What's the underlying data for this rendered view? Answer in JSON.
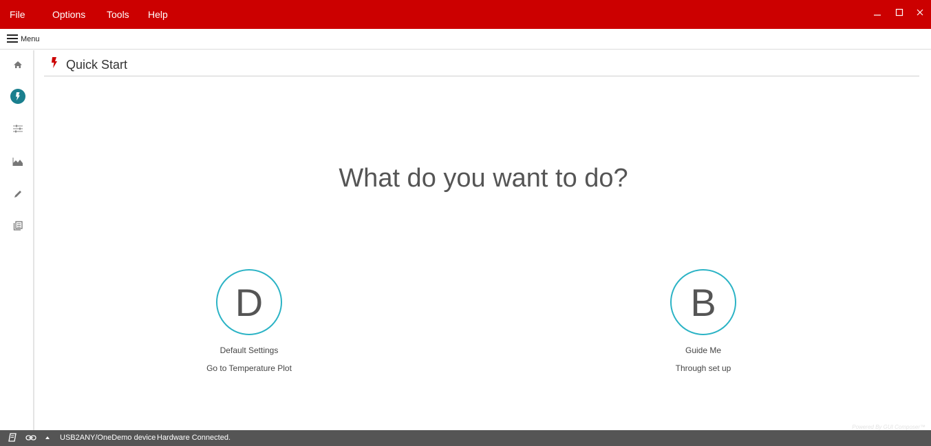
{
  "menubar": {
    "items": [
      "File",
      "Options",
      "Tools",
      "Help"
    ]
  },
  "window_controls": {
    "minimize_icon": "minimize-icon",
    "maximize_icon": "maximize-icon",
    "close_icon": "close-icon"
  },
  "secondary_menu": {
    "label": "Menu",
    "icon": "hamburger-icon"
  },
  "sidebar": {
    "items": [
      {
        "name": "home",
        "icon": "home-icon",
        "active": false
      },
      {
        "name": "quick-start",
        "icon": "bolt-icon",
        "active": true
      },
      {
        "name": "settings",
        "icon": "sliders-icon",
        "active": false
      },
      {
        "name": "plot",
        "icon": "area-chart-icon",
        "active": false
      },
      {
        "name": "edit",
        "icon": "pencil-icon",
        "active": false
      },
      {
        "name": "docs",
        "icon": "document-icon",
        "active": false
      }
    ]
  },
  "page": {
    "title": "Quick Start",
    "question": "What do you want to do?"
  },
  "options": [
    {
      "letter": "D",
      "line1": "Default Settings",
      "line2": "Go to Temperature Plot"
    },
    {
      "letter": "B",
      "line1": "Guide Me",
      "line2": "Through set up"
    }
  ],
  "status": {
    "device": "USB2ANY/OneDemo device",
    "connection": "Hardware Connected."
  },
  "footer": {
    "powered_by": "Powered By GUI Composer™"
  },
  "colors": {
    "titlebar": "#cc0000",
    "accent": "#2bb3c5",
    "active_sidebar": "#1a7f8e",
    "statusbar": "#555555"
  }
}
